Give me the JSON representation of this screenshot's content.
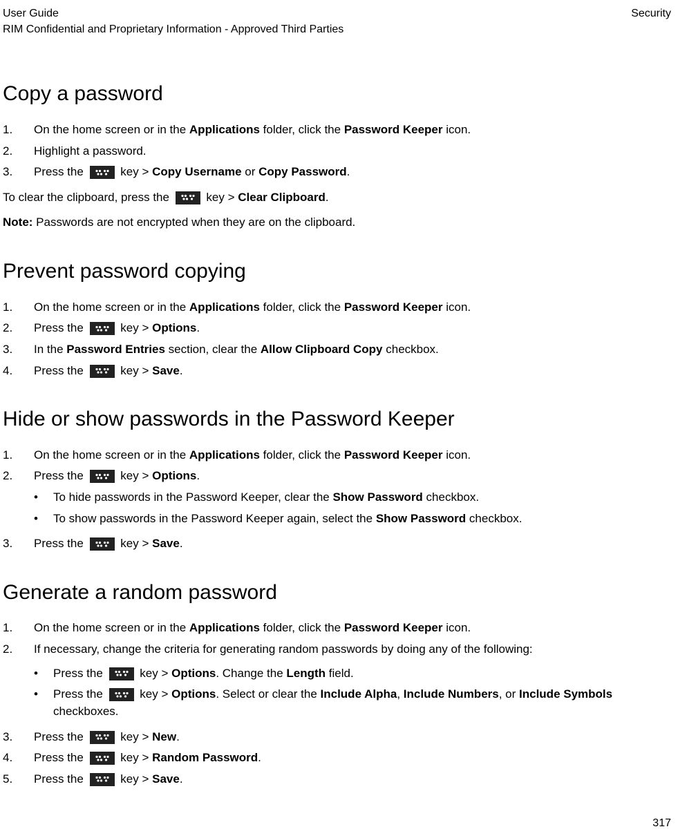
{
  "header": {
    "left_line1": "User Guide",
    "left_line2": "RIM Confidential and Proprietary Information - Approved Third Parties",
    "right": "Security"
  },
  "s1": {
    "heading": "Copy a password",
    "i1_a": "On the home screen or in the ",
    "i1_b": "Applications",
    "i1_c": " folder, click the ",
    "i1_d": "Password Keeper",
    "i1_e": " icon.",
    "i2": "Highlight a password.",
    "i3_a": "Press the ",
    "i3_b": " key > ",
    "i3_c": "Copy Username",
    "i3_d": " or ",
    "i3_e": "Copy Password",
    "i3_f": ".",
    "p_a": "To clear the clipboard, press the ",
    "p_b": " key > ",
    "p_c": "Clear Clipboard",
    "p_d": ".",
    "n_a": "Note:",
    "n_b": " Passwords are not encrypted when they are on the clipboard."
  },
  "s2": {
    "heading": "Prevent password copying",
    "i1_a": "On the home screen or in the ",
    "i1_b": "Applications",
    "i1_c": " folder, click the ",
    "i1_d": "Password Keeper",
    "i1_e": " icon.",
    "i2_a": "Press the ",
    "i2_b": " key > ",
    "i2_c": "Options",
    "i2_d": ".",
    "i3_a": "In the ",
    "i3_b": "Password Entries",
    "i3_c": " section, clear the ",
    "i3_d": "Allow Clipboard Copy",
    "i3_e": " checkbox.",
    "i4_a": "Press the ",
    "i4_b": " key > ",
    "i4_c": "Save",
    "i4_d": "."
  },
  "s3": {
    "heading": "Hide or show passwords in the Password Keeper",
    "i1_a": "On the home screen or in the ",
    "i1_b": "Applications",
    "i1_c": " folder, click the ",
    "i1_d": "Password Keeper",
    "i1_e": " icon.",
    "i2_a": "Press the ",
    "i2_b": " key > ",
    "i2_c": "Options",
    "i2_d": ".",
    "b1_a": "To hide passwords in the Password Keeper, clear the ",
    "b1_b": "Show Password",
    "b1_c": " checkbox.",
    "b2_a": "To show passwords in the Password Keeper again, select the ",
    "b2_b": "Show Password",
    "b2_c": " checkbox.",
    "i3_a": "Press the ",
    "i3_b": " key > ",
    "i3_c": "Save",
    "i3_d": "."
  },
  "s4": {
    "heading": "Generate a random password",
    "i1_a": "On the home screen or in the ",
    "i1_b": "Applications",
    "i1_c": " folder, click the ",
    "i1_d": "Password Keeper",
    "i1_e": " icon.",
    "i2": "If necessary, change the criteria for generating random passwords by doing any of the following:",
    "b1_a": "Press the ",
    "b1_b": " key > ",
    "b1_c": "Options",
    "b1_d": ". Change the ",
    "b1_e": "Length",
    "b1_f": " field.",
    "b2_a": "Press the ",
    "b2_b": " key > ",
    "b2_c": "Options",
    "b2_d": ". Select or clear the ",
    "b2_e": "Include Alpha",
    "b2_f": ", ",
    "b2_g": "Include Numbers",
    "b2_h": ", or ",
    "b2_i": "Include Symbols",
    "b2_j": " checkboxes.",
    "i3_a": "Press the ",
    "i3_b": " key > ",
    "i3_c": "New",
    "i3_d": ".",
    "i4_a": "Press the ",
    "i4_b": " key > ",
    "i4_c": "Random Password",
    "i4_d": ".",
    "i5_a": "Press the ",
    "i5_b": " key > ",
    "i5_c": "Save",
    "i5_d": "."
  },
  "page_number": "317"
}
